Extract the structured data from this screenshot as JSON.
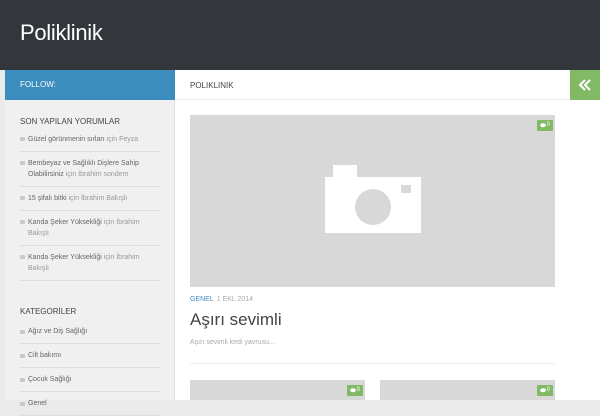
{
  "site": {
    "title": "Poliklinik"
  },
  "sidebar": {
    "follow_label": "FOLLOW:",
    "recent_comments": {
      "title": "SON YAPILAN YORUMLAR",
      "items": [
        {
          "author": "Güzel görünmenin sırları",
          "joiner": "için",
          "post": "Feyza"
        },
        {
          "author": "Bembeyaz ve Sağlıklı Dişlere Sahip Olabilirsiniz",
          "joiner": "için",
          "post": "İbrahim sondem"
        },
        {
          "author": "15 şifalı bitki",
          "joiner": "için",
          "post": "İbrahim Bakışlı"
        },
        {
          "author": "Kanda Şeker Yüksekliği",
          "joiner": "için",
          "post": "İbrahim Bakışlı"
        },
        {
          "author": "Kanda Şeker Yüksekliği",
          "joiner": "için",
          "post": "İbrahim Bakışlı"
        }
      ]
    },
    "categories": {
      "title": "KATEGORİLER",
      "items": [
        "Ağız ve Diş Sağlığı",
        "Cilt bakımı",
        "Çocuk Sağlığı",
        "Genel"
      ]
    }
  },
  "main": {
    "breadcrumb": "POLIKLINIK",
    "featured_post": {
      "comment_count": "0",
      "category": "GENEL",
      "date": "1 EKL 2014",
      "title": "Aşırı sevimli",
      "excerpt": "Aşırı sevimli kedi yavrusu..."
    },
    "grid_posts": [
      {
        "comment_count": "0"
      },
      {
        "comment_count": "0"
      }
    ]
  },
  "colors": {
    "header_bg": "#33363b",
    "follow_bg": "#3b8dbd",
    "accent_green": "#82b965",
    "link_blue": "#3b8dbd"
  },
  "icons": {
    "toggle": "double-chevron-left-icon",
    "comment": "comment-bubble-icon",
    "placeholder": "camera-icon"
  }
}
